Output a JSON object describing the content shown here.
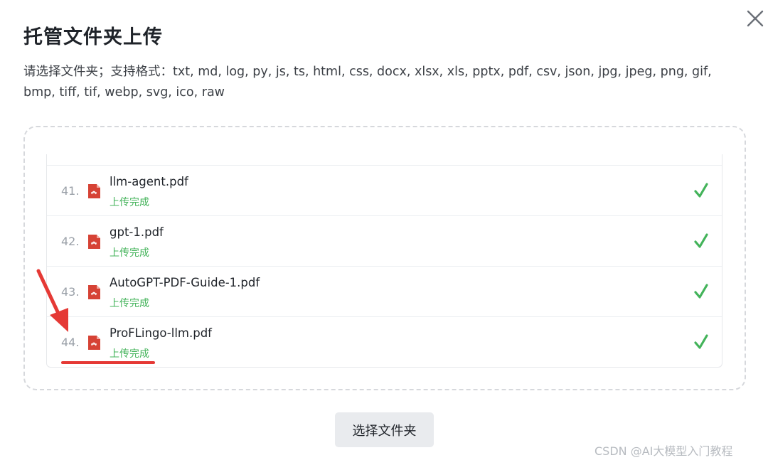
{
  "dialog": {
    "title": "托管文件夹上传",
    "description": "请选择文件夹；支持格式：txt, md, log, py, js, ts, html, css, docx, xlsx, xls, pptx, pdf, csv, json, jpg, jpeg, png, gif, bmp, tiff, tif, webp, svg, ico, raw",
    "close_icon": "close-icon"
  },
  "file_list": {
    "items": [
      {
        "index": "41.",
        "name": "llm-agent.pdf",
        "status": "上传完成",
        "icon": "pdf-icon",
        "done_icon": "check-icon"
      },
      {
        "index": "42.",
        "name": "gpt-1.pdf",
        "status": "上传完成",
        "icon": "pdf-icon",
        "done_icon": "check-icon"
      },
      {
        "index": "43.",
        "name": "AutoGPT-PDF-Guide-1.pdf",
        "status": "上传完成",
        "icon": "pdf-icon",
        "done_icon": "check-icon"
      },
      {
        "index": "44.",
        "name": "ProFLingo-llm.pdf",
        "status": "上传完成",
        "icon": "pdf-icon",
        "done_icon": "check-icon"
      }
    ]
  },
  "actions": {
    "select_folder_label": "选择文件夹"
  },
  "watermark": "CSDN @AI大模型入门教程",
  "colors": {
    "success": "#43b35a",
    "pdf_red": "#d64235",
    "annotation_red": "#e53935",
    "button_bg": "#e9ebee"
  }
}
